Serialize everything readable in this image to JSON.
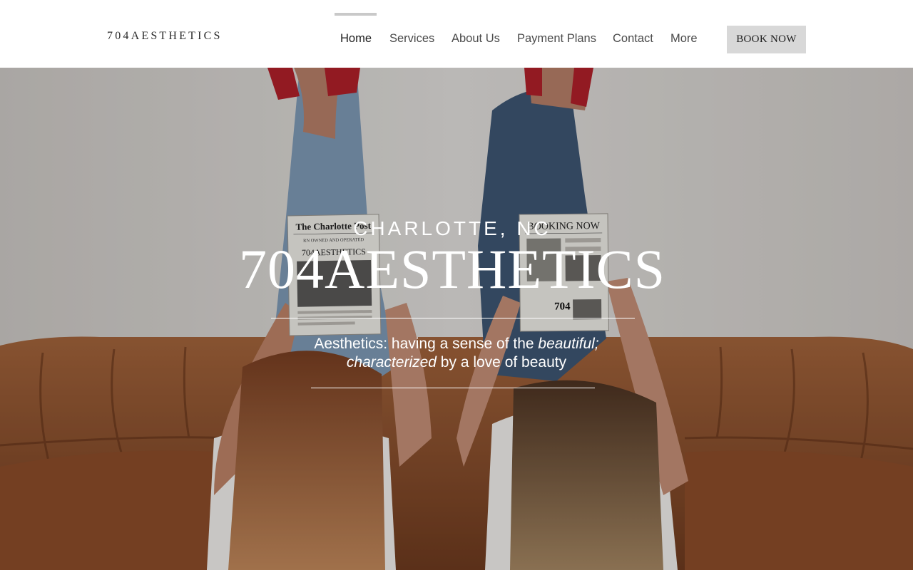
{
  "header": {
    "logo": "704AESTHETICS",
    "nav": [
      {
        "label": "Home",
        "active": true
      },
      {
        "label": "Services"
      },
      {
        "label": "About Us"
      },
      {
        "label": "Payment Plans"
      },
      {
        "label": "Contact"
      },
      {
        "label": "More"
      }
    ],
    "book_label": "BOOK NOW"
  },
  "hero": {
    "location": "CHARLOTTE, NC",
    "title": "704AESTHETICS",
    "tagline": {
      "part1": "Aesthetics: having a sense of the ",
      "italic1": "beautiful;",
      "italic2": "characterized",
      "part2": " by a love of beauty"
    },
    "photo": {
      "newspaper_left": {
        "masthead": "The Charlotte Post",
        "subhead": "RN OWNED AND OPERATED",
        "headline": "704AESTHETICS"
      },
      "newspaper_right": {
        "masthead": "BOOKING NOW",
        "number": "704"
      }
    }
  },
  "colors": {
    "header_bg": "#ffffff",
    "button_bg": "#d8d8d8",
    "hero_text": "#ffffff",
    "wall": "#d9d6d3",
    "couch": "#8a4e2c",
    "denim": "#3f5775"
  }
}
